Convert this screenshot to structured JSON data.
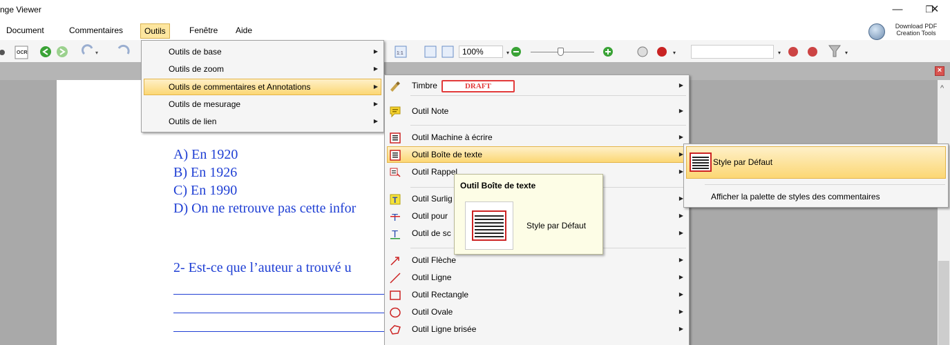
{
  "window": {
    "title": "nge Viewer",
    "minimize": "—",
    "restore": "❐",
    "close": "✕"
  },
  "menubar": {
    "items": [
      "Document",
      "Commentaires",
      "Outils",
      "Fenêtre",
      "Aide"
    ],
    "download": {
      "line1": "Download PDF",
      "line2": "Creation Tools"
    }
  },
  "toolbar": {
    "ocr_label": "OCR",
    "zoom": "100%"
  },
  "document": {
    "lines": [
      "A) En 1920",
      "B) En 1926",
      "C) En 1990",
      "D) On ne retrouve pas cette infor",
      "2- Est-ce que l’auteur a trouvé u"
    ]
  },
  "outils_menu": {
    "items": [
      "Outils de base",
      "Outils de zoom",
      "Outils de commentaires et Annotations",
      "Outils de mesurage",
      "Outils de lien"
    ]
  },
  "comment_menu": {
    "stamp_label": "Timbre",
    "stamp_text": "DRAFT",
    "items": [
      "Outil Note",
      "Outil Machine à écrire",
      "Outil Boîte de texte",
      "Outil Rappel",
      "Outil Surlig",
      "Outil pour",
      "Outil de sc",
      "Outil Flèche",
      "Outil Ligne",
      "Outil Rectangle",
      "Outil Ovale",
      "Outil Ligne brisée"
    ]
  },
  "textbox_menu": {
    "items": [
      "Style par Défaut",
      "Afficher la palette de styles des commentaires"
    ]
  },
  "tooltip": {
    "title": "Outil Boîte de texte",
    "label": "Style par Défaut"
  },
  "colors": {
    "doc_text": "#1f3fd4",
    "highlight": "#fcd774",
    "menu_bg": "#f5f5f5"
  }
}
